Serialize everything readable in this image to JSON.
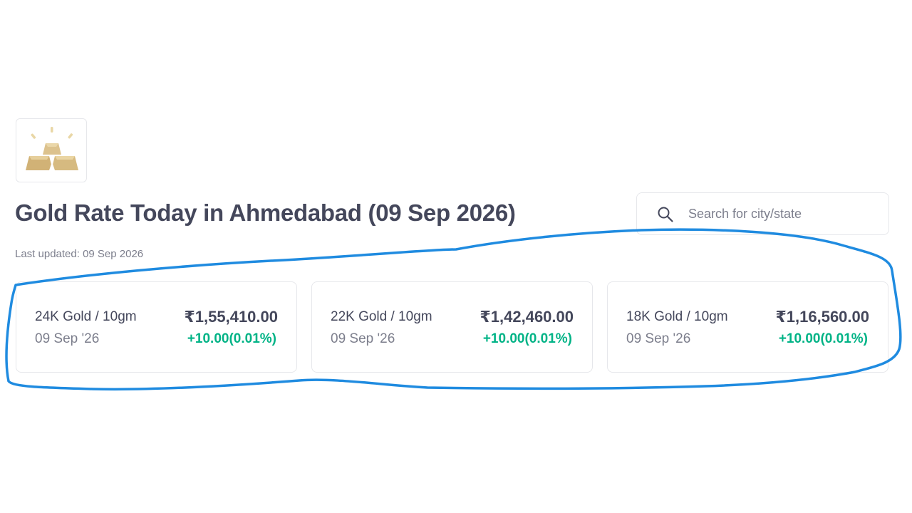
{
  "logo": {
    "icon": "gold-bars-icon"
  },
  "header": {
    "title": "Gold Rate Today in Ahmedabad (09 Sep 2026)",
    "last_updated": "Last updated: 09 Sep 2026"
  },
  "search": {
    "placeholder": "Search for city/state",
    "value": "",
    "icon": "search-icon"
  },
  "cards": [
    {
      "label": "24K Gold / 10gm",
      "date": "09 Sep '26",
      "price": "₹1,55,410.00",
      "change": "+10.00(0.01%)"
    },
    {
      "label": "22K Gold / 10gm",
      "date": "09 Sep '26",
      "price": "₹1,42,460.00",
      "change": "+10.00(0.01%)"
    },
    {
      "label": "18K Gold / 10gm",
      "date": "09 Sep '26",
      "price": "₹1,16,560.00",
      "change": "+10.00(0.01%)"
    }
  ],
  "colors": {
    "text_primary": "#44475b",
    "text_secondary": "#7c7e8c",
    "positive_change": "#00b386",
    "gold": "#d4b87a",
    "annotation_stroke": "#1f8be0"
  }
}
